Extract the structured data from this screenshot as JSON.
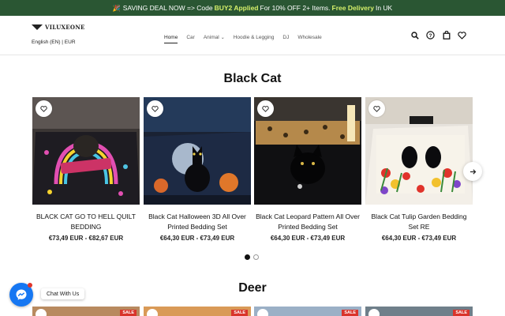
{
  "announcement": {
    "gift_icon": "gift-icon",
    "part1": "SAVING DEAL NOW => Code",
    "code": "BUY2 Applied",
    "part2": "For 10% OFF 2+ Items.",
    "delivery": "Free Delivery",
    "part3": "In UK",
    "bg_color": "#2a5633",
    "highlight_color": "#d6f06a"
  },
  "header": {
    "logo_text": "VILUXEONE",
    "language_currency": "English (EN) | EUR",
    "nav": [
      {
        "label": "Home",
        "active": true
      },
      {
        "label": "Car",
        "active": false
      },
      {
        "label": "Animal",
        "active": false,
        "has_dropdown": true
      },
      {
        "label": "Hoodie & Legging",
        "active": false
      },
      {
        "label": "DJ",
        "active": false
      },
      {
        "label": "Wholesale",
        "active": false
      }
    ],
    "icons": [
      "search-icon",
      "help-icon",
      "cart-icon",
      "wishlist-icon"
    ]
  },
  "sections": [
    {
      "title": "Black Cat",
      "products": [
        {
          "title": "BLACK CAT GO TO HELL QUILT BEDDING",
          "price": "€73,49 EUR - €82,67 EUR",
          "wishlist_icon": "heart-icon"
        },
        {
          "title": "Black Cat Halloween 3D All Over Printed Bedding Set",
          "price": "€64,30 EUR - €73,49 EUR",
          "wishlist_icon": "heart-icon"
        },
        {
          "title": "Black Cat Leopard Pattern All Over Printed Bedding Set",
          "price": "€64,30 EUR - €73,49 EUR",
          "wishlist_icon": "heart-icon"
        },
        {
          "title": "Black Cat Tulip Garden Bedding Set RE",
          "price": "€64,30 EUR - €73,49 EUR",
          "wishlist_icon": "heart-icon"
        }
      ],
      "carousel": {
        "next_icon": "arrow-right-icon",
        "pages": 2,
        "active_page": 1
      }
    },
    {
      "title": "Deer",
      "badges": [
        "SALE",
        "SALE",
        "SALE",
        "SALE"
      ]
    }
  ],
  "chat": {
    "label": "Chat With Us",
    "icon": "messenger-icon",
    "color": "#1677f2"
  }
}
